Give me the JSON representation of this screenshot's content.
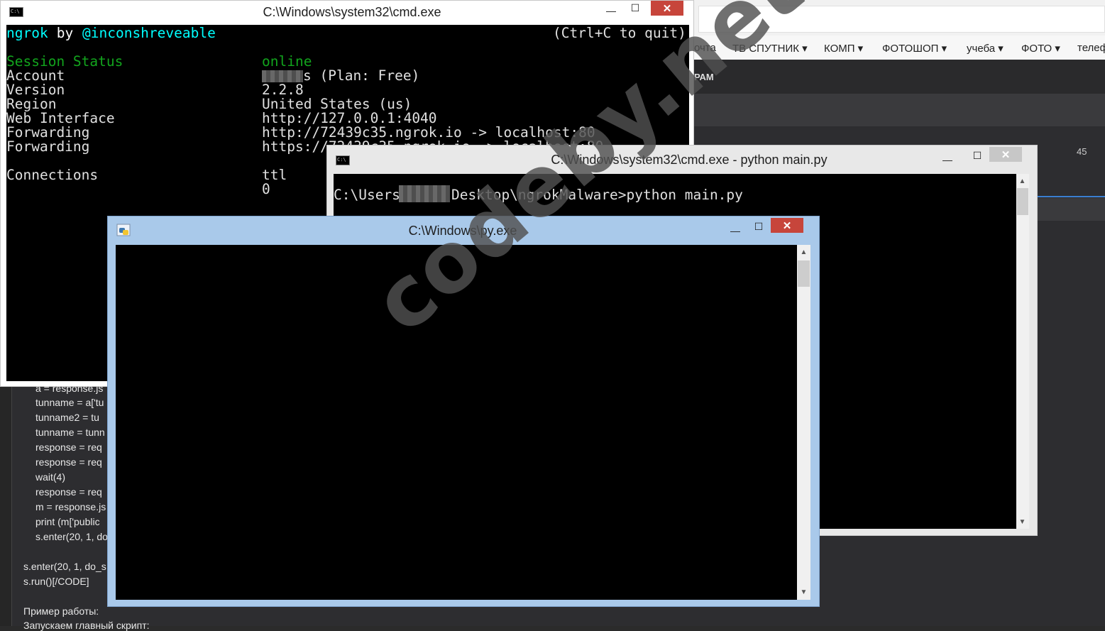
{
  "browser": {
    "bookmarks": [
      "очта",
      "ТВ СПУТНИК ▾",
      "КОМП ▾",
      "ФОТОШОП ▾",
      "учеба ▾",
      "ФОТО ▾",
      "телеф"
    ],
    "forum_menu_label": "РАМ",
    "count": "45",
    "code_lines": [
      "a = response.js",
      "tunname = a['tu",
      "tunname2 = tu",
      "tunname = tunn",
      "response = req",
      "response = req",
      "wait(4)",
      "response = req",
      "m = response.js",
      "print (m['public",
      "s.enter(20, 1, do",
      "s.enter(20, 1, do_s",
      "s.run()[/CODE]",
      "Пример работы:",
      "Запускаем главный скрипт:"
    ]
  },
  "windows": {
    "ngrok": {
      "title": "C:\\Windows\\system32\\cmd.exe",
      "header_left_app": "ngrok",
      "header_left_by": " by ",
      "header_left_author": "@inconshreveable",
      "header_right": "(Ctrl+C to quit)",
      "session_status_label": "Session Status",
      "session_status_value": "online",
      "rows": [
        {
          "label": "Account",
          "value": "s (Plan: Free)"
        },
        {
          "label": "Version",
          "value": "2.2.8"
        },
        {
          "label": "Region",
          "value": "United States (us)"
        },
        {
          "label": "Web Interface",
          "value": "http://127.0.0.1:4040"
        },
        {
          "label": "Forwarding",
          "value": "http://72439c35.ngrok.io -> localhost:80"
        },
        {
          "label": "Forwarding",
          "value": "https://72439c35.ngrok.io -> localhost:80"
        }
      ],
      "connections_label": "Connections",
      "connections_header": "ttl",
      "connections_value": "0"
    },
    "python": {
      "title": "C:\\Windows\\system32\\cmd.exe - python  main.py",
      "prompt_prefix": "C:\\Users",
      "prompt_suffix": "Desktop\\ngrokMalware>python main.py"
    },
    "pyexe": {
      "title": "C:\\Windows\\py.exe"
    }
  },
  "controls": {
    "minimize": "—",
    "maximize": "☐",
    "close": "✕",
    "scroll_up": "▲",
    "scroll_down": "▼"
  },
  "watermark": "codeby.net",
  "colors": {
    "console_bg": "#000000",
    "ngrok_cyan": "#00ffff",
    "status_green": "#12a41d",
    "close_red": "#c7453b",
    "active_frame": "#a9c9ea"
  }
}
